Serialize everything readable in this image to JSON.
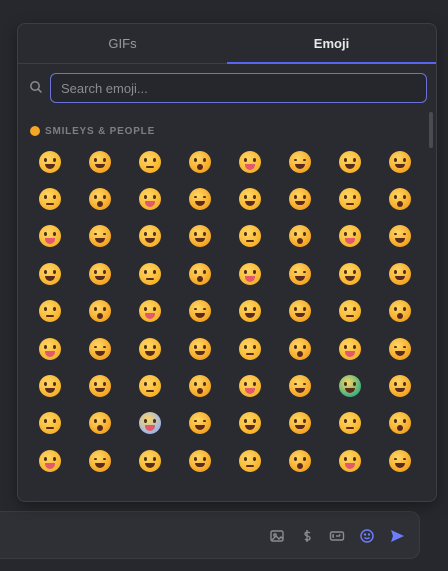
{
  "tabs": [
    {
      "label": "GIFs",
      "active": false
    },
    {
      "label": "Emoji",
      "active": true
    }
  ],
  "search": {
    "placeholder": "Search emoji..."
  },
  "category": {
    "label": "SMILEYS & PEOPLE",
    "icon": "grinning-face-icon"
  },
  "emojis": [
    {
      "name": "grinning-face",
      "color": "#f7b32b"
    },
    {
      "name": "grinning-face-with-big-eyes",
      "color": "#f5a623"
    },
    {
      "name": "grinning-squinting",
      "color": "#f7b32b"
    },
    {
      "name": "beaming-face",
      "color": "#f5a623"
    },
    {
      "name": "squinting-laughing",
      "color": "#f7b32b"
    },
    {
      "name": "grinning-sweat",
      "color": "#f5a623"
    },
    {
      "name": "rolling-laughing",
      "color": "#f7b32b"
    },
    {
      "name": "tears-of-joy",
      "color": "#f5a623"
    },
    {
      "name": "slightly-smiling",
      "color": "#f7b32b"
    },
    {
      "name": "upside-down",
      "color": "#f5a623"
    },
    {
      "name": "melting-face",
      "color": "#f7b32b"
    },
    {
      "name": "winking-face",
      "color": "#f5a623"
    },
    {
      "name": "smiling-eyes",
      "color": "#f7b32b"
    },
    {
      "name": "smiling-halo",
      "color": "#f5a623"
    },
    {
      "name": "smiling-hearts",
      "color": "#f7b32b"
    },
    {
      "name": "heart-eyes",
      "color": "#f5a623"
    },
    {
      "name": "star-struck",
      "color": "#f7b32b"
    },
    {
      "name": "blowing-kiss",
      "color": "#f5a623"
    },
    {
      "name": "kissing-face",
      "color": "#f7b32b"
    },
    {
      "name": "relaxed-face",
      "color": "#f5a623"
    },
    {
      "name": "kissing-closed-eyes",
      "color": "#f7b32b"
    },
    {
      "name": "kissing-smiling-eyes",
      "color": "#f5a623"
    },
    {
      "name": "smiling-tear",
      "color": "#f7b32b"
    },
    {
      "name": "yum-face",
      "color": "#f5a623"
    },
    {
      "name": "tongue-out",
      "color": "#f7b32b"
    },
    {
      "name": "winking-tongue",
      "color": "#f5a623"
    },
    {
      "name": "zany-face",
      "color": "#f7b32b"
    },
    {
      "name": "squinting-tongue",
      "color": "#f5a623"
    },
    {
      "name": "money-mouth",
      "color": "#f7b32b"
    },
    {
      "name": "hugging-face",
      "color": "#f5a623"
    },
    {
      "name": "saluting-face",
      "color": "#f7b32b"
    },
    {
      "name": "hand-over-mouth",
      "color": "#f5a623"
    },
    {
      "name": "open-eyes-hand-over-mouth",
      "color": "#f7b32b"
    },
    {
      "name": "peeking-eye",
      "color": "#f5a623"
    },
    {
      "name": "shushing-face",
      "color": "#f7b32b"
    },
    {
      "name": "thinking-face",
      "color": "#f5a623"
    },
    {
      "name": "zipper-mouth",
      "color": "#f7b32b"
    },
    {
      "name": "raised-eyebrow",
      "color": "#f5a623"
    },
    {
      "name": "neutral-face",
      "color": "#f7b32b"
    },
    {
      "name": "expressionless",
      "color": "#f5a623"
    },
    {
      "name": "dotted-line-face",
      "color": "#f7b32b"
    },
    {
      "name": "smirking-face",
      "color": "#f5a623"
    },
    {
      "name": "unamused-face",
      "color": "#f7b32b"
    },
    {
      "name": "rolling-eyes",
      "color": "#f5a623"
    },
    {
      "name": "grimacing",
      "color": "#f7b32b"
    },
    {
      "name": "face-exhaling",
      "color": "#f5a623"
    },
    {
      "name": "relieved-face",
      "color": "#f7b32b"
    },
    {
      "name": "pensive-face",
      "color": "#f5a623"
    },
    {
      "name": "sleepy-face",
      "color": "#f7b32b"
    },
    {
      "name": "drooling-face",
      "color": "#f5a623"
    },
    {
      "name": "sleeping-face",
      "color": "#f7b32b"
    },
    {
      "name": "medical-mask",
      "color": "#f5a623"
    },
    {
      "name": "thermometer-face",
      "color": "#f7b32b"
    },
    {
      "name": "head-bandage",
      "color": "#f5a623"
    },
    {
      "name": "nauseated-face",
      "color": "#3fb27f"
    },
    {
      "name": "vomiting-face",
      "color": "#f5a623"
    },
    {
      "name": "sneezing-face",
      "color": "#f7b32b"
    },
    {
      "name": "hot-face",
      "color": "#f5a623"
    },
    {
      "name": "cold-face",
      "color": "#9fb6e8"
    },
    {
      "name": "woozy-face",
      "color": "#f5a623"
    },
    {
      "name": "knocked-out",
      "color": "#f7b32b"
    },
    {
      "name": "exploding-head",
      "color": "#f5a623"
    },
    {
      "name": "cowboy-face",
      "color": "#f7b32b"
    },
    {
      "name": "disguised-face",
      "color": "#f5a623"
    },
    {
      "name": "partying-face",
      "color": "#f7b32b"
    },
    {
      "name": "flushed-face",
      "color": "#f5a623"
    },
    {
      "name": "sunglasses-face",
      "color": "#f7b32b"
    },
    {
      "name": "nerd-face",
      "color": "#f5a623"
    },
    {
      "name": "monocle-face",
      "color": "#f7b32b"
    },
    {
      "name": "confused-face",
      "color": "#f5a623"
    },
    {
      "name": "worried-face",
      "color": "#f7b32b"
    },
    {
      "name": "frowning-face",
      "color": "#f5a623"
    }
  ],
  "composer_tools": [
    "image-icon",
    "dollar-icon",
    "gif-icon",
    "emoji-icon",
    "send-icon"
  ]
}
